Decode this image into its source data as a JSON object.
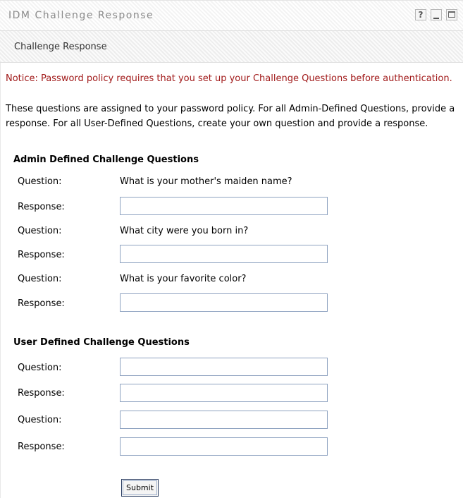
{
  "window": {
    "title": "IDM Challenge Response",
    "help_label": "?"
  },
  "subheader": {
    "label": "Challenge Response"
  },
  "notice": "Notice: Password policy requires that you set up your Challenge Questions before authentication.",
  "info": "These questions are assigned to your password policy. For all Admin-Defined Questions, provide a response. For all User-Defined Questions, create your own question and provide a response.",
  "admin": {
    "title": "Admin Defined Challenge Questions",
    "question_label": "Question:",
    "response_label": "Response:",
    "questions": [
      "What is your mother's maiden name?",
      "What city were you born in?",
      "What is your favorite color?"
    ]
  },
  "user": {
    "title": "User Defined Challenge Questions",
    "question_label": "Question:",
    "response_label": "Response:"
  },
  "submit_label": "Submit"
}
